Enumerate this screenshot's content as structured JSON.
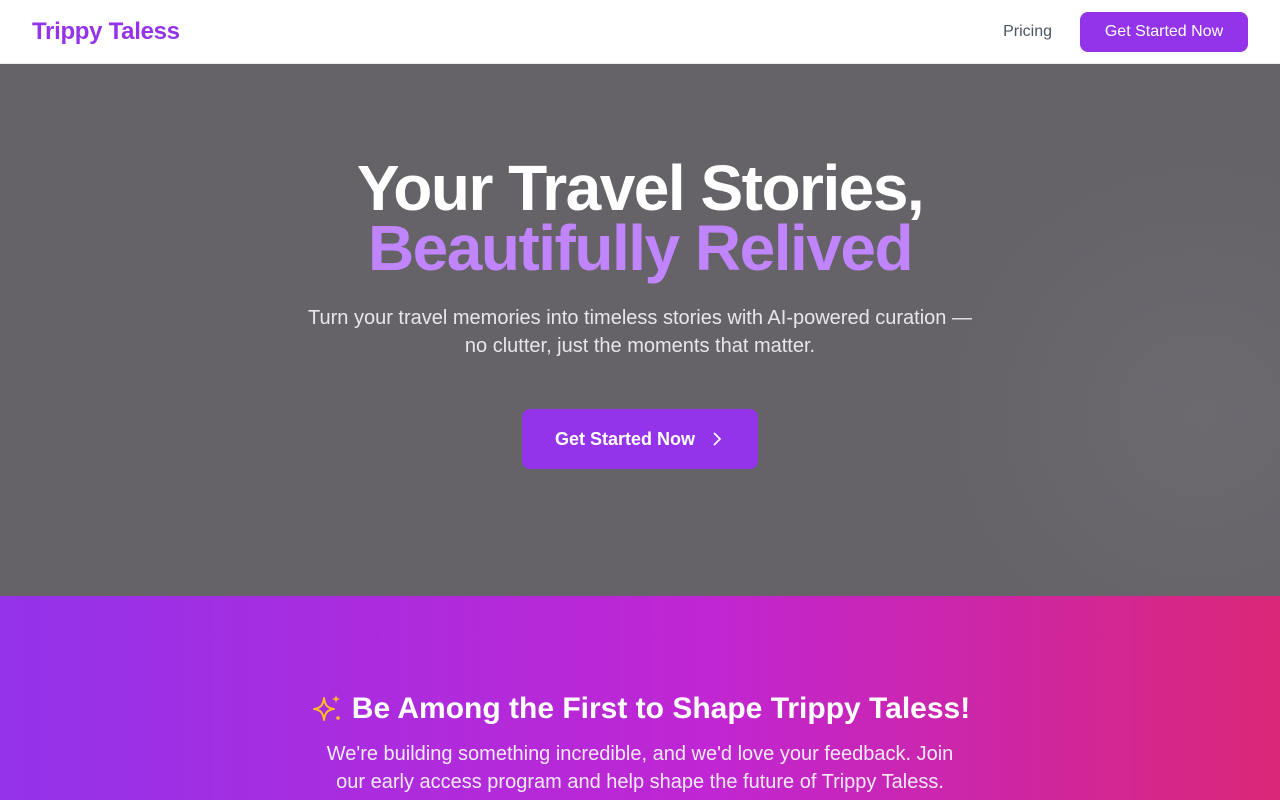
{
  "nav": {
    "brand": "Trippy Taless",
    "pricing_link": "Pricing",
    "cta_label": "Get Started Now"
  },
  "hero": {
    "title_line1": "Your Travel Stories,",
    "title_line2": "Beautifully Relived",
    "subtitle": "Turn your travel memories into timeless stories with AI-powered curation — no clutter, just the moments that matter.",
    "cta_label": "Get Started Now",
    "cta_icon": "chevron-right-icon"
  },
  "promo": {
    "icon": "sparkles-icon",
    "heading": "Be Among the First to Shape Trippy Taless!",
    "text": "We're building something incredible, and we'd love your feedback. Join our early access program and help shape the future of Trippy Taless."
  },
  "colors": {
    "brand": "#9333ea",
    "accent_text": "#c084fc",
    "hero_bg": "#656368",
    "promo_gradient_start": "#9333ea",
    "promo_gradient_end": "#db2777",
    "sparkle": "#fbbf24"
  }
}
